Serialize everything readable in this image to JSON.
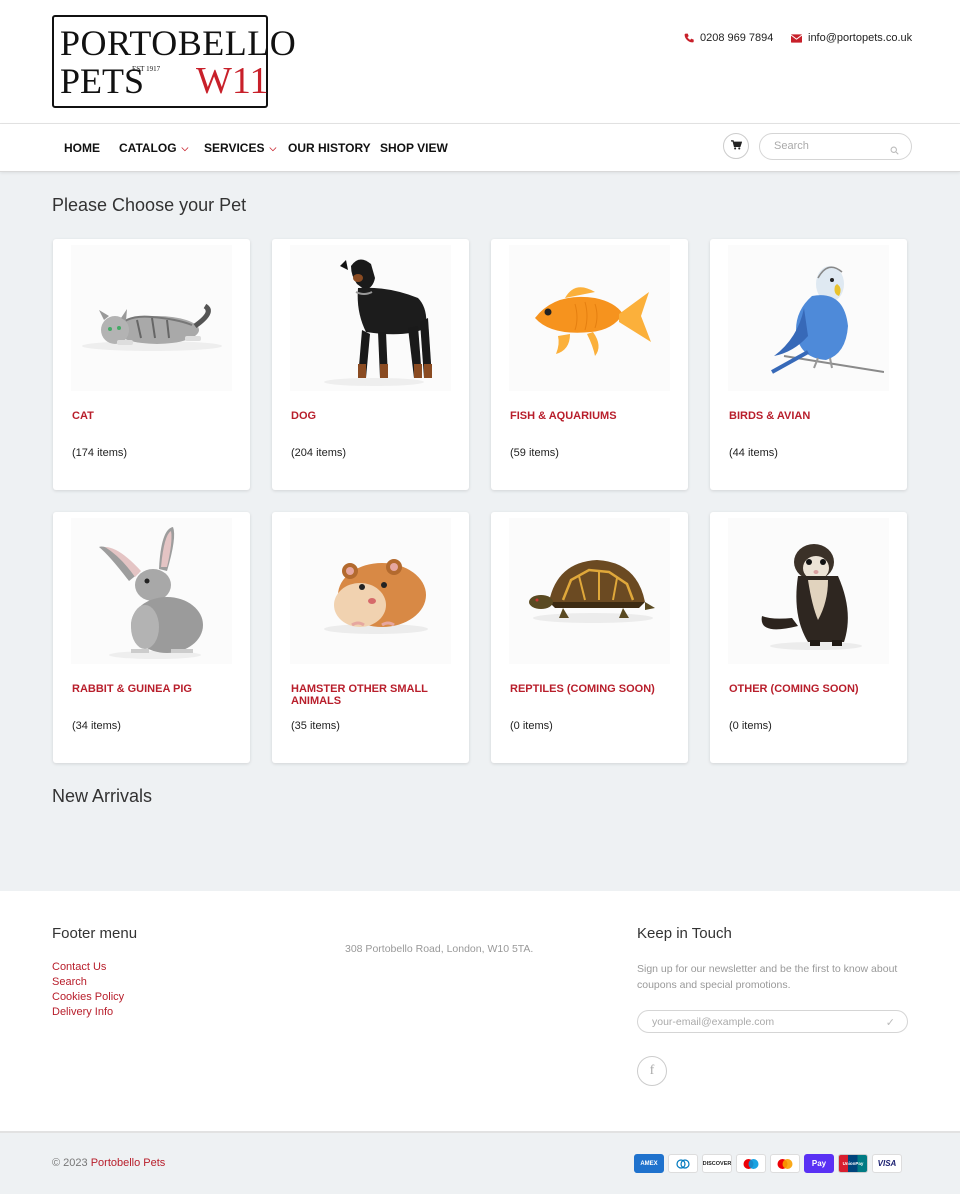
{
  "header": {
    "logo": {
      "line1": "PORTOBELLO",
      "line2": "PETS",
      "est": "EST 1917",
      "tag": "W11"
    },
    "phone": "0208 969 7894",
    "email": "info@portopets.co.uk"
  },
  "nav": {
    "items": [
      {
        "label": "HOME"
      },
      {
        "label": "CATALOG",
        "dropdown": true
      },
      {
        "label": "SERVICES",
        "dropdown": true
      },
      {
        "label": "OUR HISTORY"
      },
      {
        "label": "SHOP VIEW"
      }
    ],
    "search_placeholder": "Search"
  },
  "main": {
    "heading": "Please Choose your Pet",
    "categories": [
      {
        "title": "CAT",
        "count": "(174 items)",
        "icon": "cat-image"
      },
      {
        "title": "DOG",
        "count": "(204 items)",
        "icon": "dog-image"
      },
      {
        "title": "FISH & AQUARIUMS",
        "count": "(59 items)",
        "icon": "goldfish-image"
      },
      {
        "title": "BIRDS & AVIAN",
        "count": "(44 items)",
        "icon": "budgie-image"
      },
      {
        "title": "RABBIT & GUINEA PIG",
        "count": "(34 items)",
        "icon": "rabbit-image"
      },
      {
        "title": "HAMSTER OTHER SMALL ANIMALS",
        "count": "(35 items)",
        "icon": "hamster-image"
      },
      {
        "title": "REPTILES (COMING SOON)",
        "count": "(0 items)",
        "icon": "tortoise-image"
      },
      {
        "title": "OTHER (COMING SOON)",
        "count": "(0 items)",
        "icon": "ferret-image"
      }
    ],
    "new_arrivals_heading": "New Arrivals"
  },
  "footer": {
    "menu_heading": "Footer menu",
    "menu": [
      "Contact Us",
      "Search",
      "Cookies Policy",
      "Delivery Info"
    ],
    "address": "308 Portobello Road, London, W10 5TA.",
    "keep_heading": "Keep in Touch",
    "newsletter_text": "Sign up for our newsletter and be the first to know about coupons and special promotions.",
    "email_placeholder": "your-email@example.com",
    "copyright_prefix": "© 2023",
    "copyright_brand": "Portobello Pets",
    "payments": [
      {
        "name": "AMEX",
        "color": "#1f72cd"
      },
      {
        "name": "DC",
        "color": "#ffffff"
      },
      {
        "name": "DISCOVER",
        "color": "#ffffff"
      },
      {
        "name": "maestro",
        "color": "#ffffff"
      },
      {
        "name": "mastercard",
        "color": "#ffffff"
      },
      {
        "name": "Pay",
        "color": "#5a31f4"
      },
      {
        "name": "UnionPay",
        "color": "#d81e2f"
      },
      {
        "name": "VISA",
        "color": "#ffffff"
      }
    ]
  },
  "colors": {
    "accent": "#b81e2b",
    "logo_red": "#c8202a",
    "background": "#eef1f3"
  }
}
